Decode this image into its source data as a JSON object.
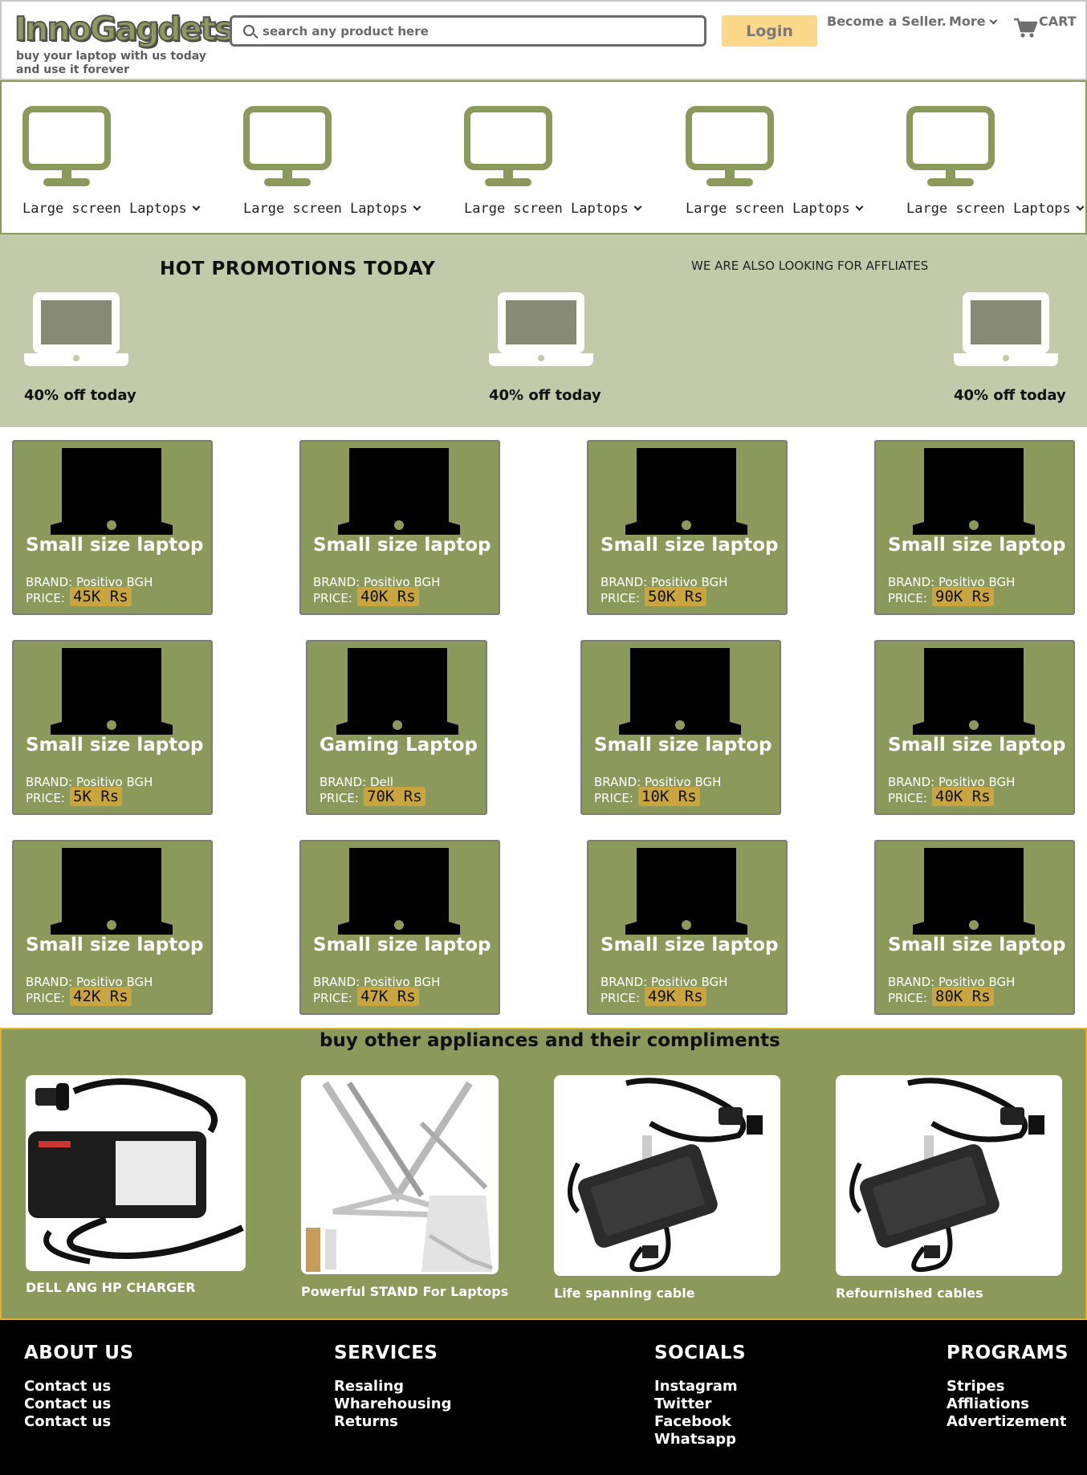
{
  "header": {
    "logo": "InnoGagdets",
    "tagline": "buy your laptop with us today and use it forever",
    "search_placeholder": "search any product here",
    "login_label": "Login",
    "seller_label": "Become a Seller.",
    "more_label": "More",
    "cart_label": "CART"
  },
  "categories": [
    {
      "label": "Large screen Laptops"
    },
    {
      "label": "Large screen Laptops"
    },
    {
      "label": "Large screen Laptops"
    },
    {
      "label": "Large screen Laptops"
    },
    {
      "label": "Large screen Laptops"
    }
  ],
  "promo": {
    "title": "HOT PROMOTIONS TODAY",
    "affiliates": "WE ARE ALSO LOOKING FOR AFFLIATES",
    "items": [
      {
        "text": "40% off today"
      },
      {
        "text": "40% off today"
      },
      {
        "text": "40% off today"
      }
    ]
  },
  "products": [
    {
      "title": "Small size laptop",
      "brand": "BRAND: Positivo BGH",
      "price_label": "PRICE:",
      "price": "45K Rs"
    },
    {
      "title": "Small size laptop",
      "brand": "BRAND: Positivo BGH",
      "price_label": "PRICE:",
      "price": "40K Rs"
    },
    {
      "title": "Small size laptop",
      "brand": "BRAND: Positivo BGH",
      "price_label": "PRICE:",
      "price": "50K Rs"
    },
    {
      "title": "Small size laptop",
      "brand": "BRAND: Positivo BGH",
      "price_label": "PRICE:",
      "price": "90K Rs"
    },
    {
      "title": "Small size laptop",
      "brand": "BRAND: Positivo BGH",
      "price_label": "PRICE:",
      "price": "5K Rs"
    },
    {
      "title": "Gaming Laptop",
      "brand": "BRAND: Dell",
      "price_label": "PRICE:",
      "price": "70K Rs"
    },
    {
      "title": "Small size laptop",
      "brand": "BRAND: Positivo BGH",
      "price_label": "PRICE:",
      "price": "10K Rs"
    },
    {
      "title": "Small size laptop",
      "brand": "BRAND: Positivo BGH",
      "price_label": "PRICE:",
      "price": "40K Rs"
    },
    {
      "title": "Small size laptop",
      "brand": "BRAND: Positivo BGH",
      "price_label": "PRICE:",
      "price": "42K Rs"
    },
    {
      "title": "Small size laptop",
      "brand": "BRAND: Positivo BGH",
      "price_label": "PRICE:",
      "price": "47K Rs"
    },
    {
      "title": "Small size laptop",
      "brand": "BRAND: Positivo BGH",
      "price_label": "PRICE:",
      "price": "49K Rs"
    },
    {
      "title": "Small size laptop",
      "brand": "BRAND: Positivo BGH",
      "price_label": "PRICE:",
      "price": "80K Rs"
    }
  ],
  "appliances": {
    "title": "buy other appliances and their compliments",
    "items": [
      {
        "caption": "DELL ANG HP CHARGER",
        "icon": "charger-image"
      },
      {
        "caption": "Powerful STAND For Laptops",
        "icon": "laptop-stand-image"
      },
      {
        "caption": "Life spanning cable",
        "icon": "cable-adapter-image"
      },
      {
        "caption": "Refournished cables",
        "icon": "cable-adapter-image"
      }
    ]
  },
  "footer": {
    "columns": [
      {
        "heading": "ABOUT US",
        "links": [
          "Contact us",
          "Contact us",
          "Contact us"
        ]
      },
      {
        "heading": "SERVICES",
        "links": [
          "Resaling",
          "Wharehousing",
          "Returns"
        ]
      },
      {
        "heading": "SOCIALS",
        "links": [
          "Instagram",
          "Twitter",
          "Facebook",
          "Whatsapp"
        ]
      },
      {
        "heading": "PROGRAMS",
        "links": [
          "Stripes",
          "Affliations",
          "Advertizement"
        ]
      }
    ]
  },
  "colors": {
    "olive": "#8b9a5a",
    "promo_bg": "#c3caa9",
    "login_bg": "#fbd88a",
    "price_bg": "#c9a540",
    "appliance_border": "#e0b02e"
  }
}
